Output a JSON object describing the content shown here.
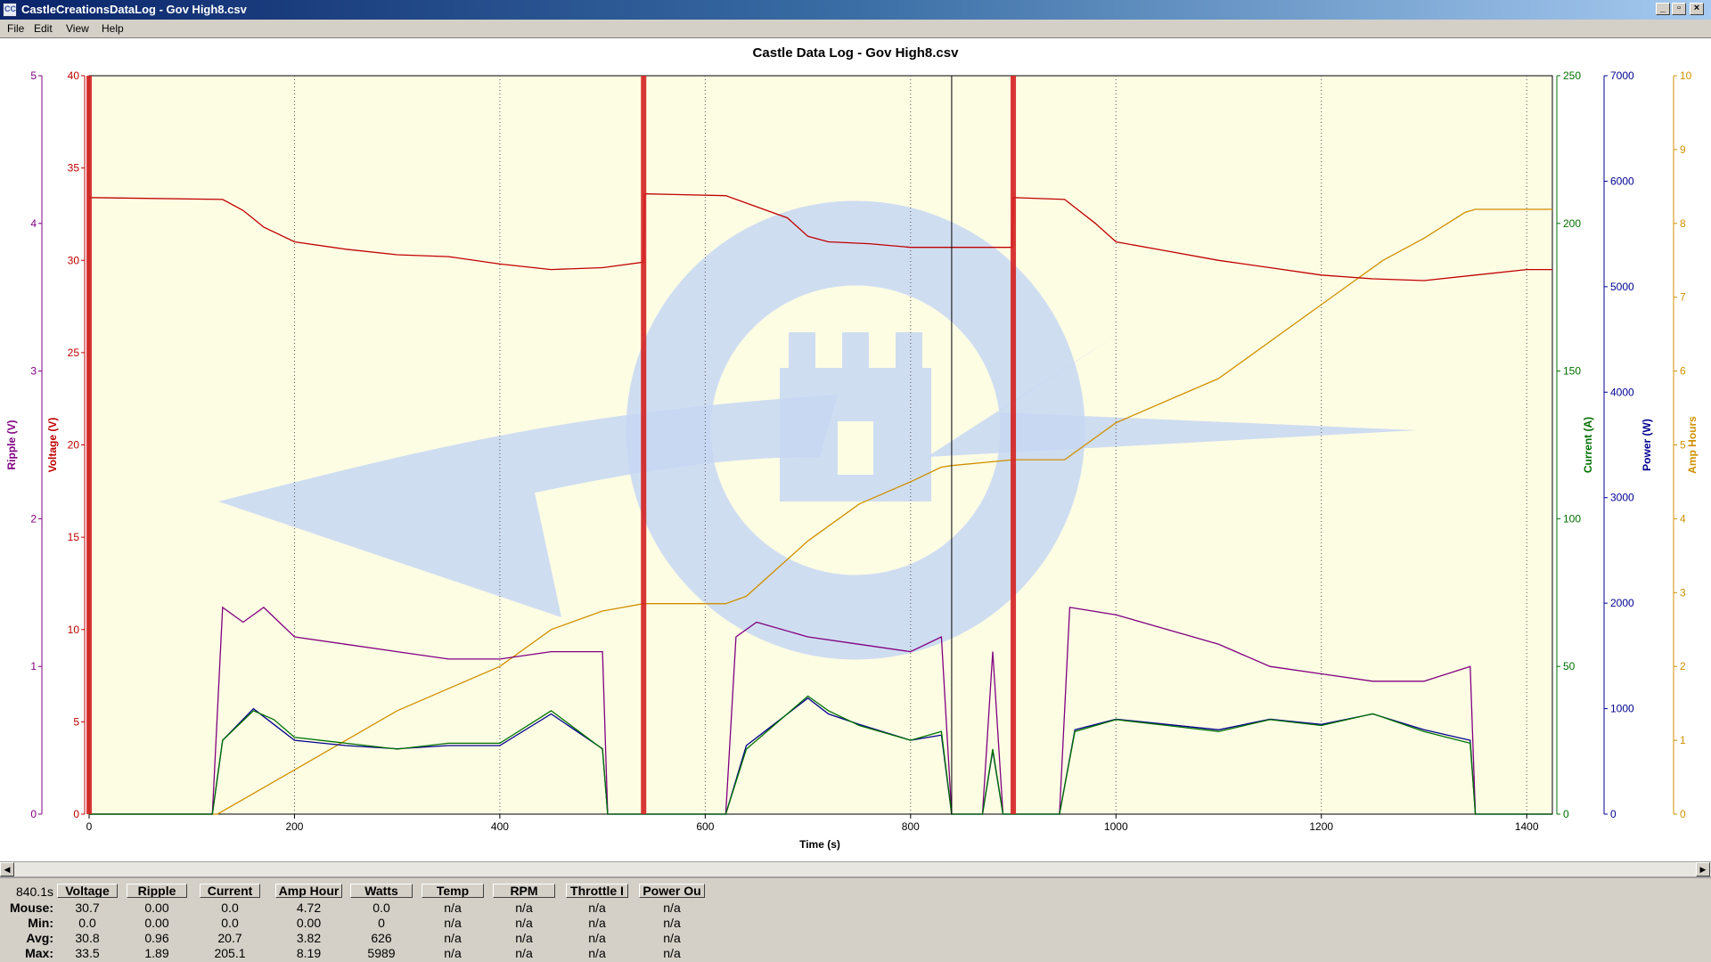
{
  "window": {
    "title": "CastleCreationsDataLog - Gov High8.csv",
    "minimize_glyph": "_",
    "maximize_glyph": "▫",
    "close_glyph": "×"
  },
  "menu": [
    "File",
    "Edit",
    "View",
    "Help"
  ],
  "colors": {
    "voltage": "#c00000",
    "ripple": "#800080",
    "current": "#007000",
    "power": "#000090",
    "amp_hours": "#d09000",
    "background": "#fdfde4",
    "cut_marker": "#d42020"
  },
  "chart_data": {
    "type": "line",
    "title": "Castle Data Log - Gov High8.csv",
    "xlabel": "Time (s)",
    "xlim": [
      0,
      1425
    ],
    "x_ticks": [
      0,
      200,
      400,
      600,
      800,
      1000,
      1200,
      1400
    ],
    "grid": "vertical dotted lines at 200 s intervals",
    "background_logo": "castle-logo",
    "cursor_time": 840,
    "segment_markers": [
      0,
      540,
      900
    ],
    "axes": [
      {
        "id": "ripple",
        "label": "Ripple (V)",
        "side": "left",
        "ylim": [
          0,
          5
        ],
        "ticks": [
          0,
          1,
          2,
          3,
          4,
          5
        ]
      },
      {
        "id": "voltage",
        "label": "Voltage (V)",
        "side": "left",
        "ylim": [
          0,
          40
        ],
        "ticks": [
          0,
          5,
          10,
          15,
          20,
          25,
          30,
          35,
          40
        ]
      },
      {
        "id": "current",
        "label": "Current (A)",
        "side": "right",
        "ylim": [
          0,
          250
        ],
        "ticks": [
          0,
          50,
          100,
          150,
          200,
          250
        ]
      },
      {
        "id": "power",
        "label": "Power (W)",
        "side": "right",
        "ylim": [
          0,
          7000
        ],
        "ticks": [
          0,
          1000,
          2000,
          3000,
          4000,
          5000,
          6000,
          7000
        ]
      },
      {
        "id": "amp_hours",
        "label": "Amp Hours",
        "side": "right",
        "ylim": [
          0,
          10
        ],
        "ticks": [
          0,
          1,
          2,
          3,
          4,
          5,
          6,
          7,
          8,
          9,
          10
        ]
      }
    ],
    "series": [
      {
        "name": "Voltage",
        "axis": "voltage",
        "points": [
          [
            0,
            33.4
          ],
          [
            130,
            33.3
          ],
          [
            150,
            32.7
          ],
          [
            170,
            31.8
          ],
          [
            200,
            31.0
          ],
          [
            250,
            30.6
          ],
          [
            300,
            30.3
          ],
          [
            350,
            30.2
          ],
          [
            400,
            29.8
          ],
          [
            450,
            29.5
          ],
          [
            500,
            29.6
          ],
          [
            540,
            29.9
          ],
          [
            541,
            33.6
          ],
          [
            620,
            33.5
          ],
          [
            650,
            32.9
          ],
          [
            680,
            32.3
          ],
          [
            700,
            31.3
          ],
          [
            720,
            31.0
          ],
          [
            760,
            30.9
          ],
          [
            800,
            30.7
          ],
          [
            840,
            30.7
          ],
          [
            870,
            30.7
          ],
          [
            899,
            30.7
          ],
          [
            900,
            33.4
          ],
          [
            950,
            33.3
          ],
          [
            980,
            32.0
          ],
          [
            1000,
            31.0
          ],
          [
            1050,
            30.5
          ],
          [
            1100,
            30.0
          ],
          [
            1150,
            29.6
          ],
          [
            1200,
            29.2
          ],
          [
            1250,
            29.0
          ],
          [
            1300,
            28.9
          ],
          [
            1350,
            29.2
          ],
          [
            1400,
            29.5
          ],
          [
            1425,
            29.5
          ]
        ]
      },
      {
        "name": "Ripple",
        "axis": "ripple",
        "points": [
          [
            0,
            0
          ],
          [
            120,
            0
          ],
          [
            130,
            1.4
          ],
          [
            150,
            1.3
          ],
          [
            170,
            1.4
          ],
          [
            200,
            1.2
          ],
          [
            250,
            1.15
          ],
          [
            300,
            1.1
          ],
          [
            350,
            1.05
          ],
          [
            400,
            1.05
          ],
          [
            450,
            1.1
          ],
          [
            500,
            1.1
          ],
          [
            505,
            0
          ],
          [
            540,
            0
          ],
          [
            620,
            0
          ],
          [
            630,
            1.2
          ],
          [
            650,
            1.3
          ],
          [
            700,
            1.2
          ],
          [
            750,
            1.15
          ],
          [
            800,
            1.1
          ],
          [
            830,
            1.2
          ],
          [
            840,
            0
          ],
          [
            870,
            0
          ],
          [
            880,
            1.1
          ],
          [
            890,
            0
          ],
          [
            900,
            0
          ],
          [
            945,
            0
          ],
          [
            955,
            1.4
          ],
          [
            1000,
            1.35
          ],
          [
            1050,
            1.25
          ],
          [
            1100,
            1.15
          ],
          [
            1150,
            1.0
          ],
          [
            1200,
            0.95
          ],
          [
            1250,
            0.9
          ],
          [
            1300,
            0.9
          ],
          [
            1345,
            1.0
          ],
          [
            1350,
            0
          ],
          [
            1425,
            0
          ]
        ]
      },
      {
        "name": "Current",
        "axis": "current",
        "points": [
          [
            0,
            0
          ],
          [
            120,
            0
          ],
          [
            130,
            25
          ],
          [
            160,
            35
          ],
          [
            180,
            32
          ],
          [
            200,
            26
          ],
          [
            250,
            24
          ],
          [
            300,
            22
          ],
          [
            350,
            24
          ],
          [
            400,
            24
          ],
          [
            450,
            35
          ],
          [
            500,
            22
          ],
          [
            505,
            0
          ],
          [
            540,
            0
          ],
          [
            620,
            0
          ],
          [
            640,
            22
          ],
          [
            660,
            28
          ],
          [
            700,
            40
          ],
          [
            720,
            35
          ],
          [
            750,
            30
          ],
          [
            800,
            25
          ],
          [
            830,
            28
          ],
          [
            840,
            0
          ],
          [
            870,
            0
          ],
          [
            880,
            22
          ],
          [
            890,
            0
          ],
          [
            900,
            0
          ],
          [
            945,
            0
          ],
          [
            960,
            28
          ],
          [
            1000,
            32
          ],
          [
            1050,
            30
          ],
          [
            1100,
            28
          ],
          [
            1150,
            32
          ],
          [
            1200,
            30
          ],
          [
            1250,
            34
          ],
          [
            1300,
            28
          ],
          [
            1345,
            24
          ],
          [
            1350,
            0
          ],
          [
            1425,
            0
          ]
        ]
      },
      {
        "name": "Power",
        "axis": "power",
        "points": [
          [
            0,
            0
          ],
          [
            120,
            0
          ],
          [
            130,
            700
          ],
          [
            160,
            1000
          ],
          [
            180,
            850
          ],
          [
            200,
            700
          ],
          [
            250,
            650
          ],
          [
            300,
            620
          ],
          [
            350,
            650
          ],
          [
            400,
            650
          ],
          [
            450,
            950
          ],
          [
            500,
            620
          ],
          [
            505,
            0
          ],
          [
            540,
            0
          ],
          [
            620,
            0
          ],
          [
            640,
            650
          ],
          [
            660,
            800
          ],
          [
            700,
            1100
          ],
          [
            720,
            950
          ],
          [
            750,
            850
          ],
          [
            800,
            700
          ],
          [
            830,
            750
          ],
          [
            840,
            0
          ],
          [
            870,
            0
          ],
          [
            880,
            600
          ],
          [
            890,
            0
          ],
          [
            900,
            0
          ],
          [
            945,
            0
          ],
          [
            960,
            800
          ],
          [
            1000,
            900
          ],
          [
            1050,
            850
          ],
          [
            1100,
            800
          ],
          [
            1150,
            900
          ],
          [
            1200,
            850
          ],
          [
            1250,
            950
          ],
          [
            1300,
            800
          ],
          [
            1345,
            700
          ],
          [
            1350,
            0
          ],
          [
            1425,
            0
          ]
        ]
      },
      {
        "name": "Amp Hours",
        "axis": "amp_hours",
        "points": [
          [
            0,
            0
          ],
          [
            125,
            0
          ],
          [
            200,
            0.6
          ],
          [
            300,
            1.4
          ],
          [
            400,
            2.0
          ],
          [
            450,
            2.5
          ],
          [
            500,
            2.75
          ],
          [
            540,
            2.85
          ],
          [
            620,
            2.85
          ],
          [
            640,
            2.95
          ],
          [
            700,
            3.7
          ],
          [
            750,
            4.2
          ],
          [
            800,
            4.5
          ],
          [
            830,
            4.7
          ],
          [
            840,
            4.72
          ],
          [
            900,
            4.8
          ],
          [
            950,
            4.8
          ],
          [
            1000,
            5.3
          ],
          [
            1100,
            5.9
          ],
          [
            1200,
            6.9
          ],
          [
            1260,
            7.5
          ],
          [
            1300,
            7.8
          ],
          [
            1340,
            8.15
          ],
          [
            1350,
            8.19
          ],
          [
            1425,
            8.19
          ]
        ]
      }
    ]
  },
  "stats": {
    "time": "840.1s",
    "columns": [
      "Voltage",
      "Ripple",
      "Current",
      "Amp Hour",
      "Watts",
      "Temp",
      "RPM",
      "Throttle I",
      "Power Ou"
    ],
    "rows": [
      {
        "label": "Mouse:",
        "values": [
          "30.7",
          "0.00",
          "0.0",
          "4.72",
          "0.0",
          "n/a",
          "n/a",
          "n/a",
          "n/a"
        ]
      },
      {
        "label": "Min:",
        "values": [
          "0.0",
          "0.00",
          "0.0",
          "0.00",
          "0",
          "n/a",
          "n/a",
          "n/a",
          "n/a"
        ]
      },
      {
        "label": "Avg:",
        "values": [
          "30.8",
          "0.96",
          "20.7",
          "3.82",
          "626",
          "n/a",
          "n/a",
          "n/a",
          "n/a"
        ]
      },
      {
        "label": "Max:",
        "values": [
          "33.5",
          "1.89",
          "205.1",
          "8.19",
          "5989",
          "n/a",
          "n/a",
          "n/a",
          "n/a"
        ]
      }
    ]
  }
}
